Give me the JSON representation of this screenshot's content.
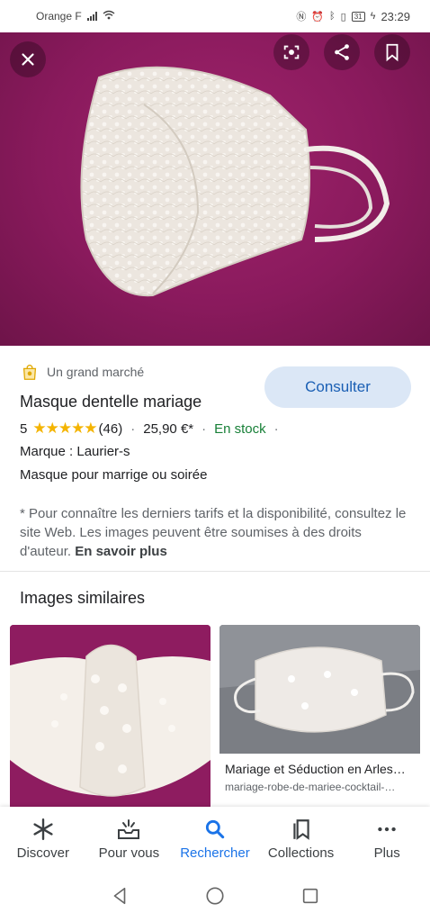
{
  "status_bar": {
    "carrier": "Orange F",
    "battery": "31",
    "time": "23:29"
  },
  "hero": {
    "icons": [
      "close-icon",
      "lens-icon",
      "share-icon",
      "bookmark-icon"
    ]
  },
  "product": {
    "merchant": "Un grand marché",
    "title": "Masque dentelle mariage",
    "rating_value": "5",
    "stars": "★★★★★",
    "review_count": "(46)",
    "price": "25,90 €*",
    "stock": "En stock",
    "brand": "Marque : Laurier-s",
    "description": "Masque pour marrige ou soirée",
    "consult_label": "Consulter",
    "disclaimer": "* Pour connaître les derniers tarifs et la disponibilité, consultez le site Web. Les images peuvent être soumises à des droits d'auteur.",
    "learn_more": "En savoir plus"
  },
  "similar": {
    "heading": "Images similaires",
    "items": [
      {
        "title": "",
        "source": ""
      },
      {
        "title": "Mariage et Séduction en Arles…",
        "source": "mariage-robe-de-mariee-cocktail-…"
      }
    ]
  },
  "bottom_nav": {
    "items": [
      {
        "label": "Discover",
        "icon": "asterisk-icon"
      },
      {
        "label": "Pour vous",
        "icon": "inbox-icon"
      },
      {
        "label": "Rechercher",
        "icon": "search-icon"
      },
      {
        "label": "Collections",
        "icon": "collections-icon"
      },
      {
        "label": "Plus",
        "icon": "more-icon"
      }
    ],
    "active_index": 2
  },
  "colors": {
    "accent": "#1a73e8",
    "consult_bg": "#dbe7f6",
    "stars": "#f4b400",
    "stock": "#188038",
    "hero_bg": "#8a1a5d"
  }
}
